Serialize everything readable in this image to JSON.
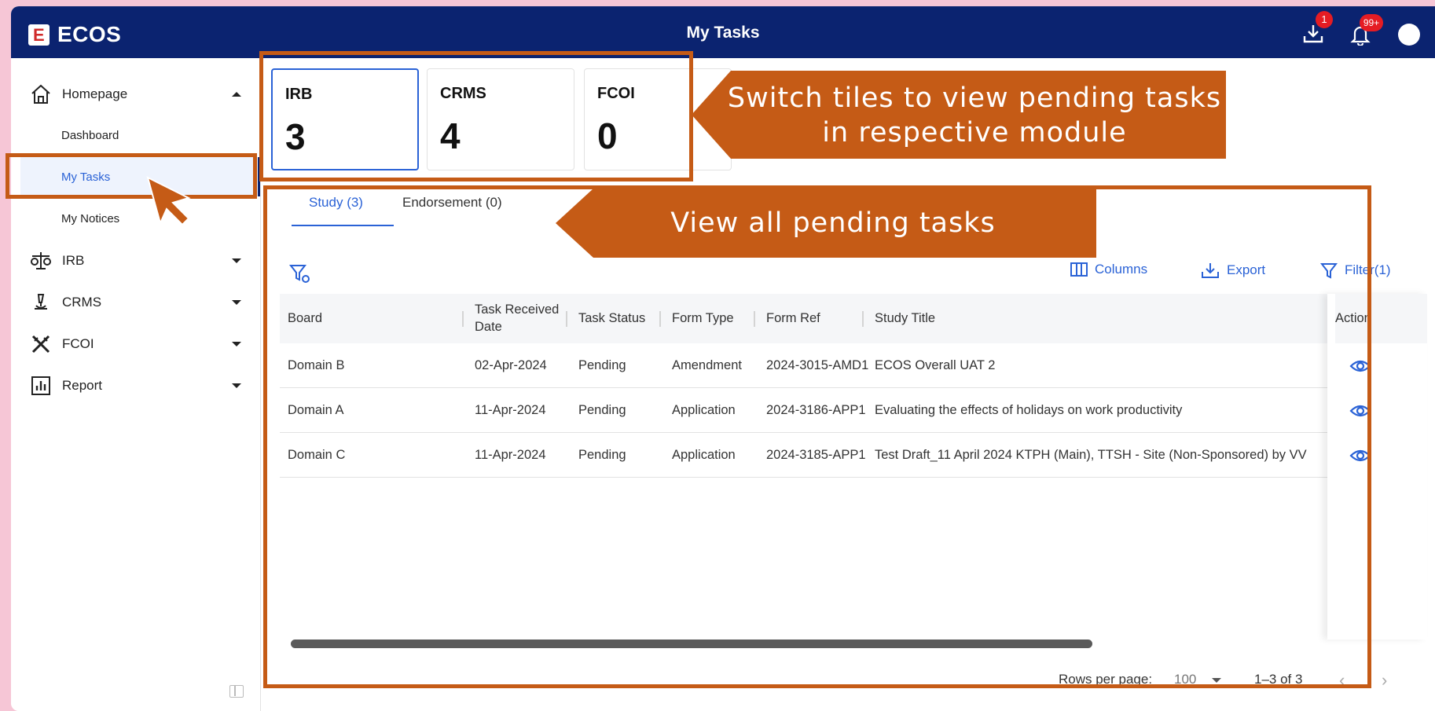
{
  "app": {
    "name": "ECOS",
    "logo_letter": "E",
    "page_title": "My Tasks"
  },
  "topbar": {
    "download_badge": "1",
    "notifications_badge": "99+",
    "icons": [
      "download-icon",
      "bell-icon",
      "avatar"
    ]
  },
  "sidebar": {
    "homepage": {
      "label": "Homepage",
      "icon": "home-icon"
    },
    "sub_items": [
      "Dashboard",
      "My Tasks",
      "My Notices"
    ],
    "items": [
      {
        "label": "IRB",
        "icon": "scales-icon"
      },
      {
        "label": "CRMS",
        "icon": "microscope-icon"
      },
      {
        "label": "FCOI",
        "icon": "tools-icon"
      },
      {
        "label": "Report",
        "icon": "report-icon"
      }
    ]
  },
  "tiles": [
    {
      "name": "IRB",
      "count": "3"
    },
    {
      "name": "CRMS",
      "count": "4"
    },
    {
      "name": "FCOI",
      "count": "0"
    }
  ],
  "tabs": [
    {
      "label": "Study (3)"
    },
    {
      "label": "Endorsement (0)"
    }
  ],
  "toolbar": {
    "columns": "Columns",
    "export": "Export",
    "filter": "Filter(1)"
  },
  "table": {
    "headers": [
      "Board",
      "Task Received Date",
      "Task Status",
      "Form Type",
      "Form Ref",
      "Study Title",
      "Action"
    ],
    "rows": [
      [
        "Domain B",
        "02-Apr-2024",
        "Pending",
        "Amendment",
        "2024-3015-AMD1",
        "ECOS Overall UAT 2"
      ],
      [
        "Domain A",
        "11-Apr-2024",
        "Pending",
        "Application",
        "2024-3186-APP1",
        "Evaluating the effects of holidays on work productivity"
      ],
      [
        "Domain C",
        "11-Apr-2024",
        "Pending",
        "Application",
        "2024-3185-APP1",
        "Test Draft_11 April 2024 KTPH (Main), TTSH - Site (Non-Sponsored) by VV"
      ]
    ]
  },
  "pagination": {
    "rows_per_page_label": "Rows per page:",
    "rows_per_page_value": "100",
    "range": "1–3 of 3"
  },
  "annotations": {
    "tiles_callout_line1": "Switch tiles to view pending tasks",
    "tiles_callout_line2": "in respective module",
    "tasks_callout": "View all pending tasks",
    "annotation_color": "#c55b16"
  },
  "colors": {
    "topbar": "#0b2370",
    "accent": "#2a62d6",
    "badge": "#e51c23"
  }
}
